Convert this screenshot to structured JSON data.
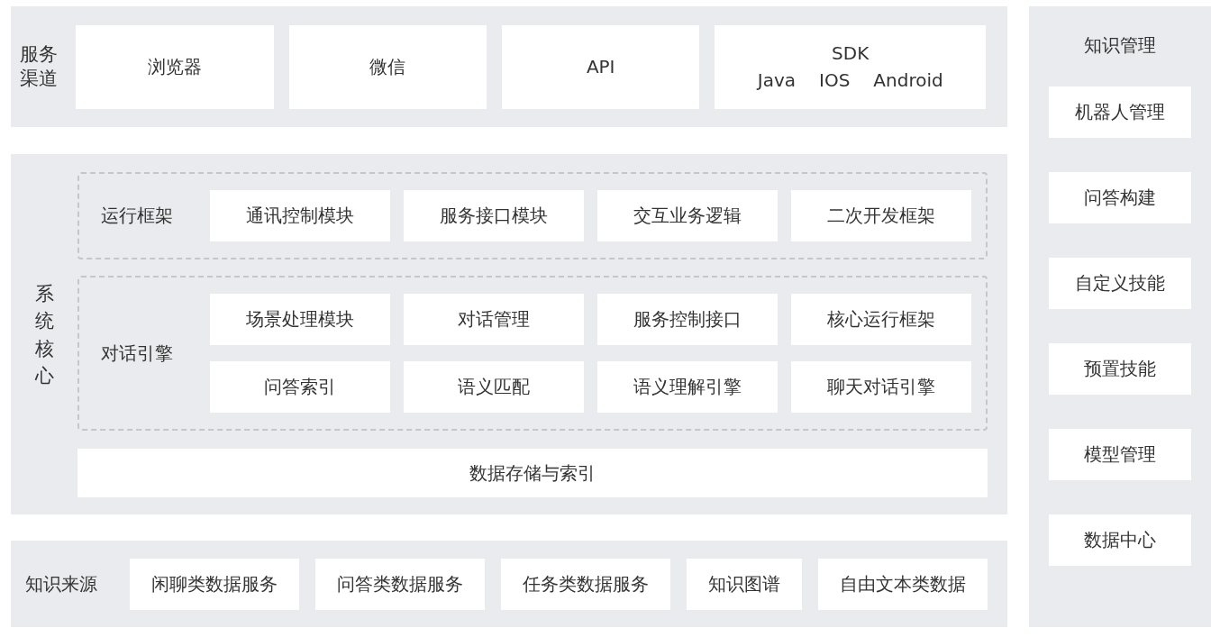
{
  "service_channels": {
    "label": "服务渠道",
    "channels": [
      {
        "kind": "plain",
        "label": "浏览器"
      },
      {
        "kind": "plain",
        "label": "微信"
      },
      {
        "kind": "plain",
        "label": "API"
      },
      {
        "kind": "sdk",
        "label": "SDK",
        "platforms": [
          "Java",
          "IOS",
          "Android"
        ]
      }
    ]
  },
  "system_core": {
    "label": "系统核心",
    "groups": [
      {
        "label": "运行框架",
        "rows": [
          [
            "通讯控制模块",
            "服务接口模块",
            "交互业务逻辑",
            "二次开发框架"
          ]
        ]
      },
      {
        "label": "对话引擎",
        "rows": [
          [
            "场景处理模块",
            "对话管理",
            "服务控制接口",
            "核心运行框架"
          ],
          [
            "问答索引",
            "语义匹配",
            "语义理解引擎",
            "聊天对话引擎"
          ]
        ]
      }
    ],
    "storage": "数据存储与索引"
  },
  "knowledge_sources": {
    "label": "知识来源",
    "items": [
      "闲聊类数据服务",
      "问答类数据服务",
      "任务类数据服务",
      "知识图谱",
      "自由文本类数据"
    ]
  },
  "knowledge_management": {
    "title": "知识管理",
    "items": [
      "机器人管理",
      "问答构建",
      "自定义技能",
      "预置技能",
      "模型管理",
      "数据中心"
    ]
  }
}
